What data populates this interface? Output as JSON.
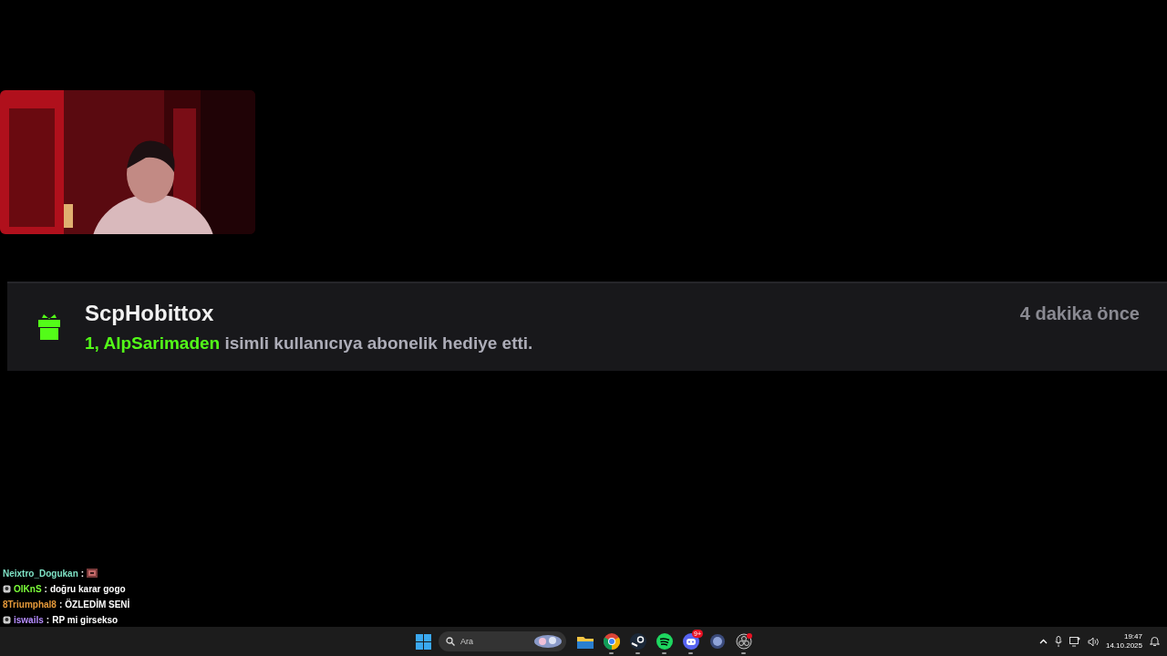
{
  "gift_notification": {
    "sender": "ScpHobittox",
    "highlight": "1, AlpSarimaden",
    "text": "isimli kullanıcıya abonelik hediye etti.",
    "time": "4 dakika önce"
  },
  "chat": [
    {
      "user": "Neixtro_Dogukan",
      "color": "#7fe3c6",
      "badge": false,
      "separator": ":",
      "kind": "emote"
    },
    {
      "user": "OlKnS",
      "color": "#7cff3a",
      "badge": true,
      "separator": ":",
      "kind": "text",
      "message": "doğru karar gogo"
    },
    {
      "user": "8Triumphal8",
      "color": "#e69a3a",
      "badge": false,
      "separator": ":",
      "kind": "text",
      "message": "ÖZLEDİM SENİ"
    },
    {
      "user": "iswails",
      "color": "#b58cff",
      "badge": true,
      "separator": ":",
      "kind": "text",
      "message": "RP mi girsekso"
    }
  ],
  "taskbar": {
    "search": {
      "placeholder": "Ara"
    },
    "apps": [
      {
        "kind": "folder",
        "running": false
      },
      {
        "kind": "chrome",
        "running": true
      },
      {
        "kind": "steam",
        "running": true
      },
      {
        "kind": "spotify",
        "running": true
      },
      {
        "kind": "discord",
        "running": true,
        "badge": "9+"
      },
      {
        "kind": "orb",
        "running": false
      },
      {
        "kind": "obs",
        "running": true
      }
    ],
    "time": "19:47",
    "date": "14.10.2025"
  }
}
